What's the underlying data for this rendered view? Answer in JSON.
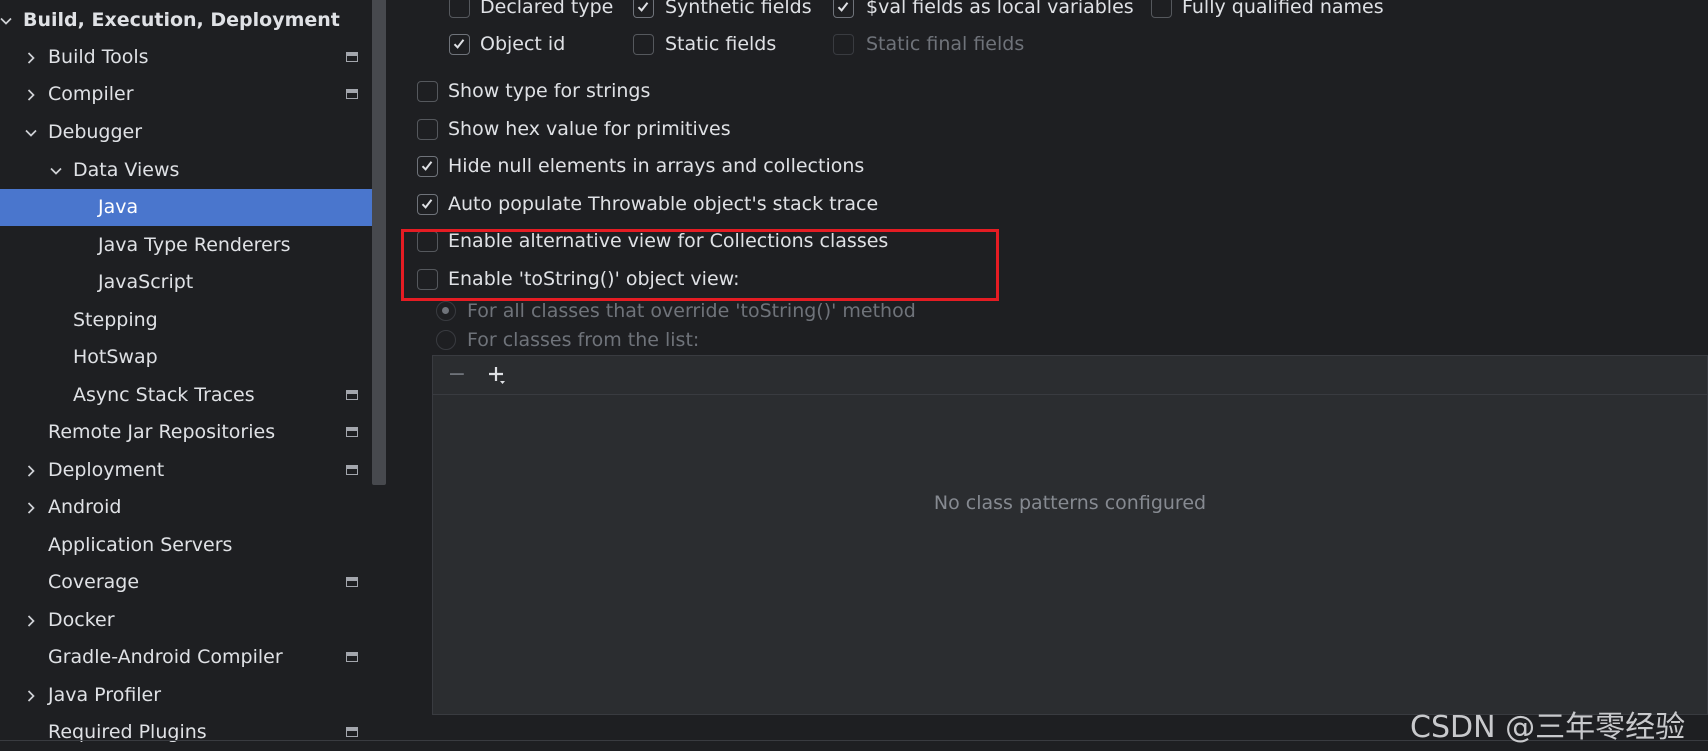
{
  "sidebar": {
    "section_title": "Build, Execution, Deployment",
    "items": [
      {
        "label": "Build Tools"
      },
      {
        "label": "Compiler"
      },
      {
        "label": "Debugger"
      },
      {
        "label": "Data Views"
      },
      {
        "label": "Java"
      },
      {
        "label": "Java Type Renderers"
      },
      {
        "label": "JavaScript"
      },
      {
        "label": "Stepping"
      },
      {
        "label": "HotSwap"
      },
      {
        "label": "Async Stack Traces"
      },
      {
        "label": "Remote Jar Repositories"
      },
      {
        "label": "Deployment"
      },
      {
        "label": "Android"
      },
      {
        "label": "Application Servers"
      },
      {
        "label": "Coverage"
      },
      {
        "label": "Docker"
      },
      {
        "label": "Gradle-Android Compiler"
      },
      {
        "label": "Java Profiler"
      },
      {
        "label": "Required Plugins"
      }
    ]
  },
  "main": {
    "fields": {
      "declared_type": "Declared type",
      "synthetic_fields": "Synthetic fields",
      "val_fields": "$val fields as local variables",
      "fully_qualified": "Fully qualified names",
      "object_id": "Object id",
      "static_fields": "Static fields",
      "static_final_fields": "Static final fields"
    },
    "options": {
      "show_type_strings": "Show type for strings",
      "show_hex": "Show hex value for primitives",
      "hide_null": "Hide null elements in arrays and collections",
      "auto_populate": "Auto populate Throwable object's stack trace",
      "alt_view": "Enable alternative view for Collections classes",
      "tostring_view": "Enable 'toString()' object view:"
    },
    "radios": {
      "all_classes": "For all classes that override 'toString()' method",
      "from_list": "For classes from the list:"
    },
    "pattern_list": {
      "remove_label": "−",
      "empty_text": "No class patterns configured"
    }
  },
  "watermark": "CSDN @三年零经验",
  "colors": {
    "accent_selection": "#4a76cd",
    "highlight_box": "#e51c23",
    "background": "#1e1f22",
    "panel": "#2b2d30"
  }
}
